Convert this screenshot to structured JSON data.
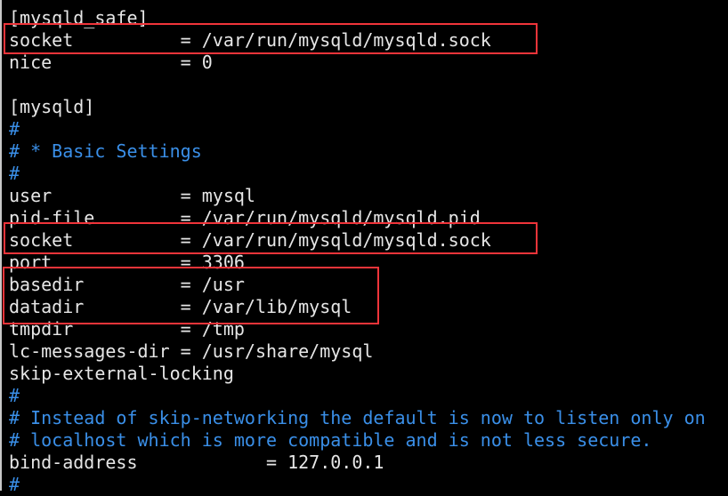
{
  "terminal": {
    "lines": [
      {
        "text": "[mysqld_safe]",
        "type": "text"
      },
      {
        "text": "socket          = /var/run/mysqld/mysqld.sock",
        "type": "text"
      },
      {
        "text": "nice            = 0",
        "type": "text"
      },
      {
        "text": "",
        "type": "text"
      },
      {
        "text": "[mysqld]",
        "type": "text"
      },
      {
        "text": "#",
        "type": "comment"
      },
      {
        "text": "# * Basic Settings",
        "type": "comment"
      },
      {
        "text": "#",
        "type": "comment"
      },
      {
        "text": "user            = mysql",
        "type": "text"
      },
      {
        "text": "pid-file        = /var/run/mysqld/mysqld.pid",
        "type": "text"
      },
      {
        "text": "socket          = /var/run/mysqld/mysqld.sock",
        "type": "text"
      },
      {
        "text": "port            = 3306",
        "type": "text"
      },
      {
        "text": "basedir         = /usr",
        "type": "text"
      },
      {
        "text": "datadir         = /var/lib/mysql",
        "type": "text"
      },
      {
        "text": "tmpdir          = /tmp",
        "type": "text"
      },
      {
        "text": "lc-messages-dir = /usr/share/mysql",
        "type": "text"
      },
      {
        "text": "skip-external-locking",
        "type": "text"
      },
      {
        "text": "#",
        "type": "comment"
      },
      {
        "text": "# Instead of skip-networking the default is now to listen only on",
        "type": "comment"
      },
      {
        "text": "# localhost which is more compatible and is not less secure.",
        "type": "comment"
      },
      {
        "text": "bind-address            = 127.0.0.1",
        "type": "text"
      },
      {
        "text": "#",
        "type": "comment"
      }
    ]
  },
  "colors": {
    "background": "#000000",
    "text": "#e6e6e6",
    "comment": "#3a8fe8",
    "highlight_box": "#f0343a"
  }
}
